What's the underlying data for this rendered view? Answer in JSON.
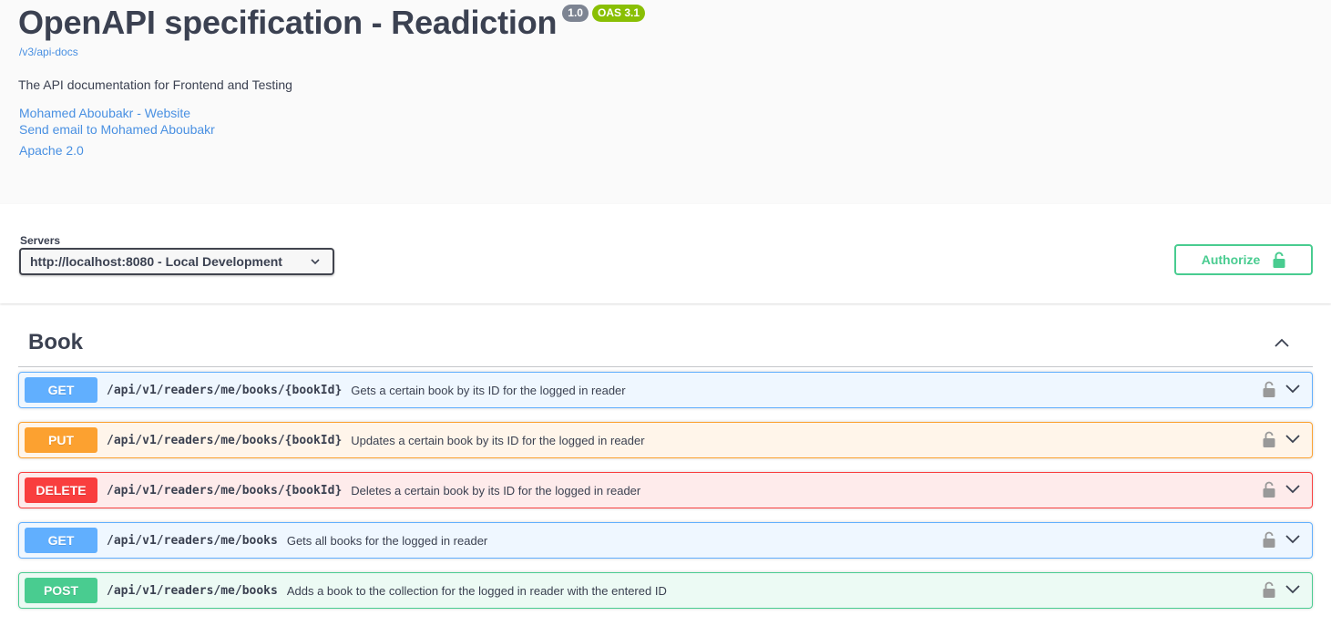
{
  "info": {
    "title": "OpenAPI specification - Readiction",
    "version_badge": "1.0",
    "oas_badge": "OAS 3.1",
    "spec_url": "/v3/api-docs",
    "description": "The API documentation for Frontend and Testing",
    "contact_website": "Mohamed Aboubakr - Website",
    "contact_email": "Send email to Mohamed Aboubakr",
    "license": "Apache 2.0"
  },
  "servers": {
    "label": "Servers",
    "selected": "http://localhost:8080 - Local Development"
  },
  "authorize": {
    "label": "Authorize"
  },
  "tag": {
    "name": "Book",
    "operations": [
      {
        "method": "GET",
        "path": "/api/v1/readers/me/books/{bookId}",
        "summary": "Gets a certain book by its ID for the logged in reader"
      },
      {
        "method": "PUT",
        "path": "/api/v1/readers/me/books/{bookId}",
        "summary": "Updates a certain book by its ID for the logged in reader"
      },
      {
        "method": "DELETE",
        "path": "/api/v1/readers/me/books/{bookId}",
        "summary": "Deletes a certain book by its ID for the logged in reader"
      },
      {
        "method": "GET",
        "path": "/api/v1/readers/me/books",
        "summary": "Gets all books for the logged in reader"
      },
      {
        "method": "POST",
        "path": "/api/v1/readers/me/books",
        "summary": "Adds a book to the collection for the logged in reader with the entered ID"
      }
    ]
  },
  "colors": {
    "get": "#61affe",
    "put": "#fca130",
    "delete": "#f93e3e",
    "post": "#49cc90",
    "link": "#4990e2",
    "text": "#3b4151"
  }
}
